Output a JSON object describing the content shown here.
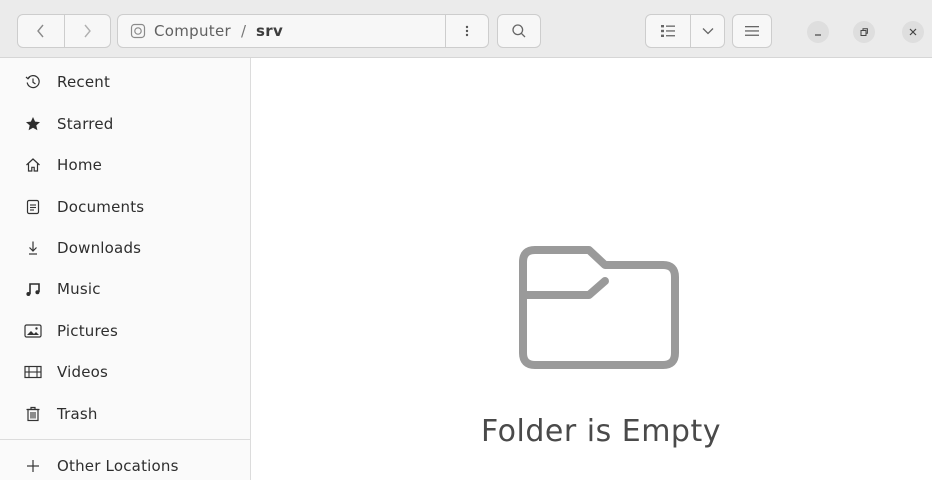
{
  "header": {
    "path": {
      "root_label": "Computer",
      "separator": "/",
      "current": "srv"
    },
    "icons": {
      "back": "chevron-left-icon",
      "forward": "chevron-right-icon",
      "path_menu": "vertical-dots-icon",
      "search": "search-icon",
      "view": "list-view-icon",
      "view_options": "chevron-down-icon",
      "main_menu": "hamburger-menu-icon",
      "minimize": "minimize-icon",
      "maximize": "maximize-icon",
      "close": "close-icon"
    }
  },
  "sidebar": {
    "items": [
      {
        "label": "Recent",
        "icon": "clock-icon"
      },
      {
        "label": "Starred",
        "icon": "star-icon"
      },
      {
        "label": "Home",
        "icon": "home-icon"
      },
      {
        "label": "Documents",
        "icon": "document-icon"
      },
      {
        "label": "Downloads",
        "icon": "download-icon"
      },
      {
        "label": "Music",
        "icon": "music-icon"
      },
      {
        "label": "Pictures",
        "icon": "picture-icon"
      },
      {
        "label": "Videos",
        "icon": "video-icon"
      },
      {
        "label": "Trash",
        "icon": "trash-icon"
      }
    ],
    "other_locations": {
      "label": "Other Locations",
      "icon": "plus-icon"
    }
  },
  "main": {
    "empty_message": "Folder is Empty",
    "empty_icon": "folder-icon"
  }
}
